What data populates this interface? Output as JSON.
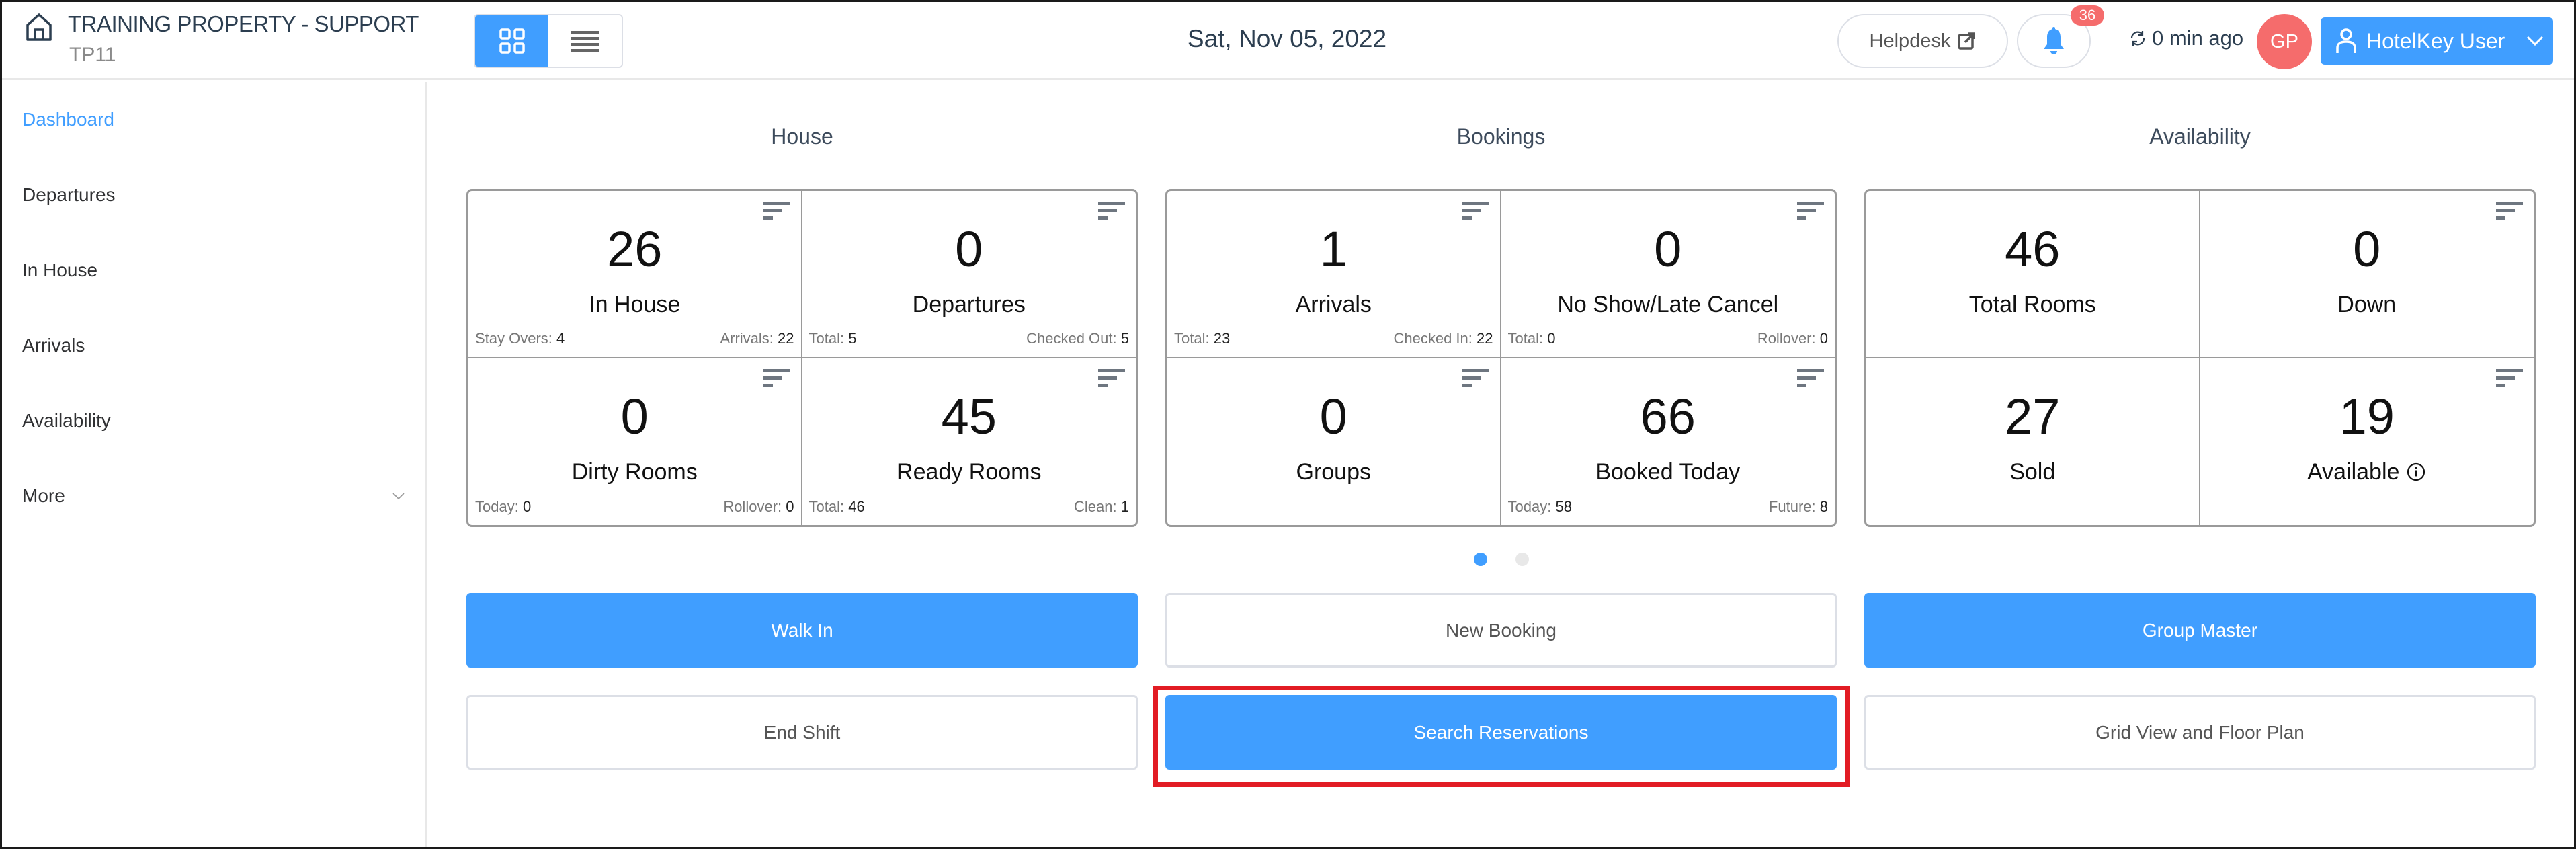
{
  "header": {
    "property_name": "TRAINING PROPERTY - SUPPORT",
    "property_code": "TP11",
    "view_modes": [
      {
        "name": "grid",
        "icon": "grid-icon",
        "active": true
      },
      {
        "name": "list",
        "icon": "list-icon",
        "active": false
      }
    ],
    "date": "Sat, Nov 05, 2022",
    "helpdesk_label": "Helpdesk",
    "notification_count": "36",
    "last_refresh": "0 min ago",
    "avatar_initials": "GP",
    "user_name": "HotelKey User"
  },
  "sidebar": {
    "items": [
      {
        "label": "Dashboard",
        "active": true
      },
      {
        "label": "Departures"
      },
      {
        "label": "In House"
      },
      {
        "label": "Arrivals"
      },
      {
        "label": "Availability"
      },
      {
        "label": "More",
        "has_submenu": true
      }
    ]
  },
  "sections": [
    {
      "title": "House",
      "tiles": [
        {
          "value": "26",
          "label": "In House",
          "foot_left_label": "Stay Overs:",
          "foot_left_value": "4",
          "foot_right_label": "Arrivals:",
          "foot_right_value": "22",
          "filter": true
        },
        {
          "value": "0",
          "label": "Departures",
          "foot_left_label": "Total:",
          "foot_left_value": "5",
          "foot_right_label": "Checked Out:",
          "foot_right_value": "5",
          "filter": true
        },
        {
          "value": "0",
          "label": "Dirty Rooms",
          "foot_left_label": "Today:",
          "foot_left_value": "0",
          "foot_right_label": "Rollover:",
          "foot_right_value": "0",
          "filter": true
        },
        {
          "value": "45",
          "label": "Ready Rooms",
          "foot_left_label": "Total:",
          "foot_left_value": "46",
          "foot_right_label": "Clean:",
          "foot_right_value": "1",
          "filter": true
        }
      ]
    },
    {
      "title": "Bookings",
      "tiles": [
        {
          "value": "1",
          "label": "Arrivals",
          "foot_left_label": "Total:",
          "foot_left_value": "23",
          "foot_right_label": "Checked In:",
          "foot_right_value": "22",
          "filter": true
        },
        {
          "value": "0",
          "label": "No Show/Late Cancel",
          "foot_left_label": "Total:",
          "foot_left_value": "0",
          "foot_right_label": "Rollover:",
          "foot_right_value": "0",
          "filter": true
        },
        {
          "value": "0",
          "label": "Groups",
          "foot_left_label": "",
          "foot_left_value": "",
          "foot_right_label": "",
          "foot_right_value": "",
          "filter": true
        },
        {
          "value": "66",
          "label": "Booked Today",
          "foot_left_label": "Today:",
          "foot_left_value": "58",
          "foot_right_label": "Future:",
          "foot_right_value": "8",
          "filter": true
        }
      ]
    },
    {
      "title": "Availability",
      "tiles": [
        {
          "value": "46",
          "label": "Total Rooms",
          "foot_left_label": "",
          "foot_left_value": "",
          "foot_right_label": "",
          "foot_right_value": "",
          "filter": false
        },
        {
          "value": "0",
          "label": "Down",
          "foot_left_label": "",
          "foot_left_value": "",
          "foot_right_label": "",
          "foot_right_value": "",
          "filter": true
        },
        {
          "value": "27",
          "label": "Sold",
          "foot_left_label": "",
          "foot_left_value": "",
          "foot_right_label": "",
          "foot_right_value": "",
          "filter": false
        },
        {
          "value": "19",
          "label": "Available",
          "info_icon": true,
          "foot_left_label": "",
          "foot_left_value": "",
          "foot_right_label": "",
          "foot_right_value": "",
          "filter": true
        }
      ]
    }
  ],
  "carousel": {
    "pages": 2,
    "current": 1
  },
  "actions": [
    {
      "label": "Walk In",
      "style": "primary"
    },
    {
      "label": "New Booking",
      "style": "plain"
    },
    {
      "label": "Group Master",
      "style": "primary"
    },
    {
      "label": "End Shift",
      "style": "plain"
    },
    {
      "label": "Search Reservations",
      "style": "primary",
      "highlighted": true
    },
    {
      "label": "Grid View and Floor Plan",
      "style": "plain"
    }
  ],
  "colors": {
    "primary": "#409eff",
    "badge": "#f56c6c",
    "highlight": "#e21c24"
  }
}
